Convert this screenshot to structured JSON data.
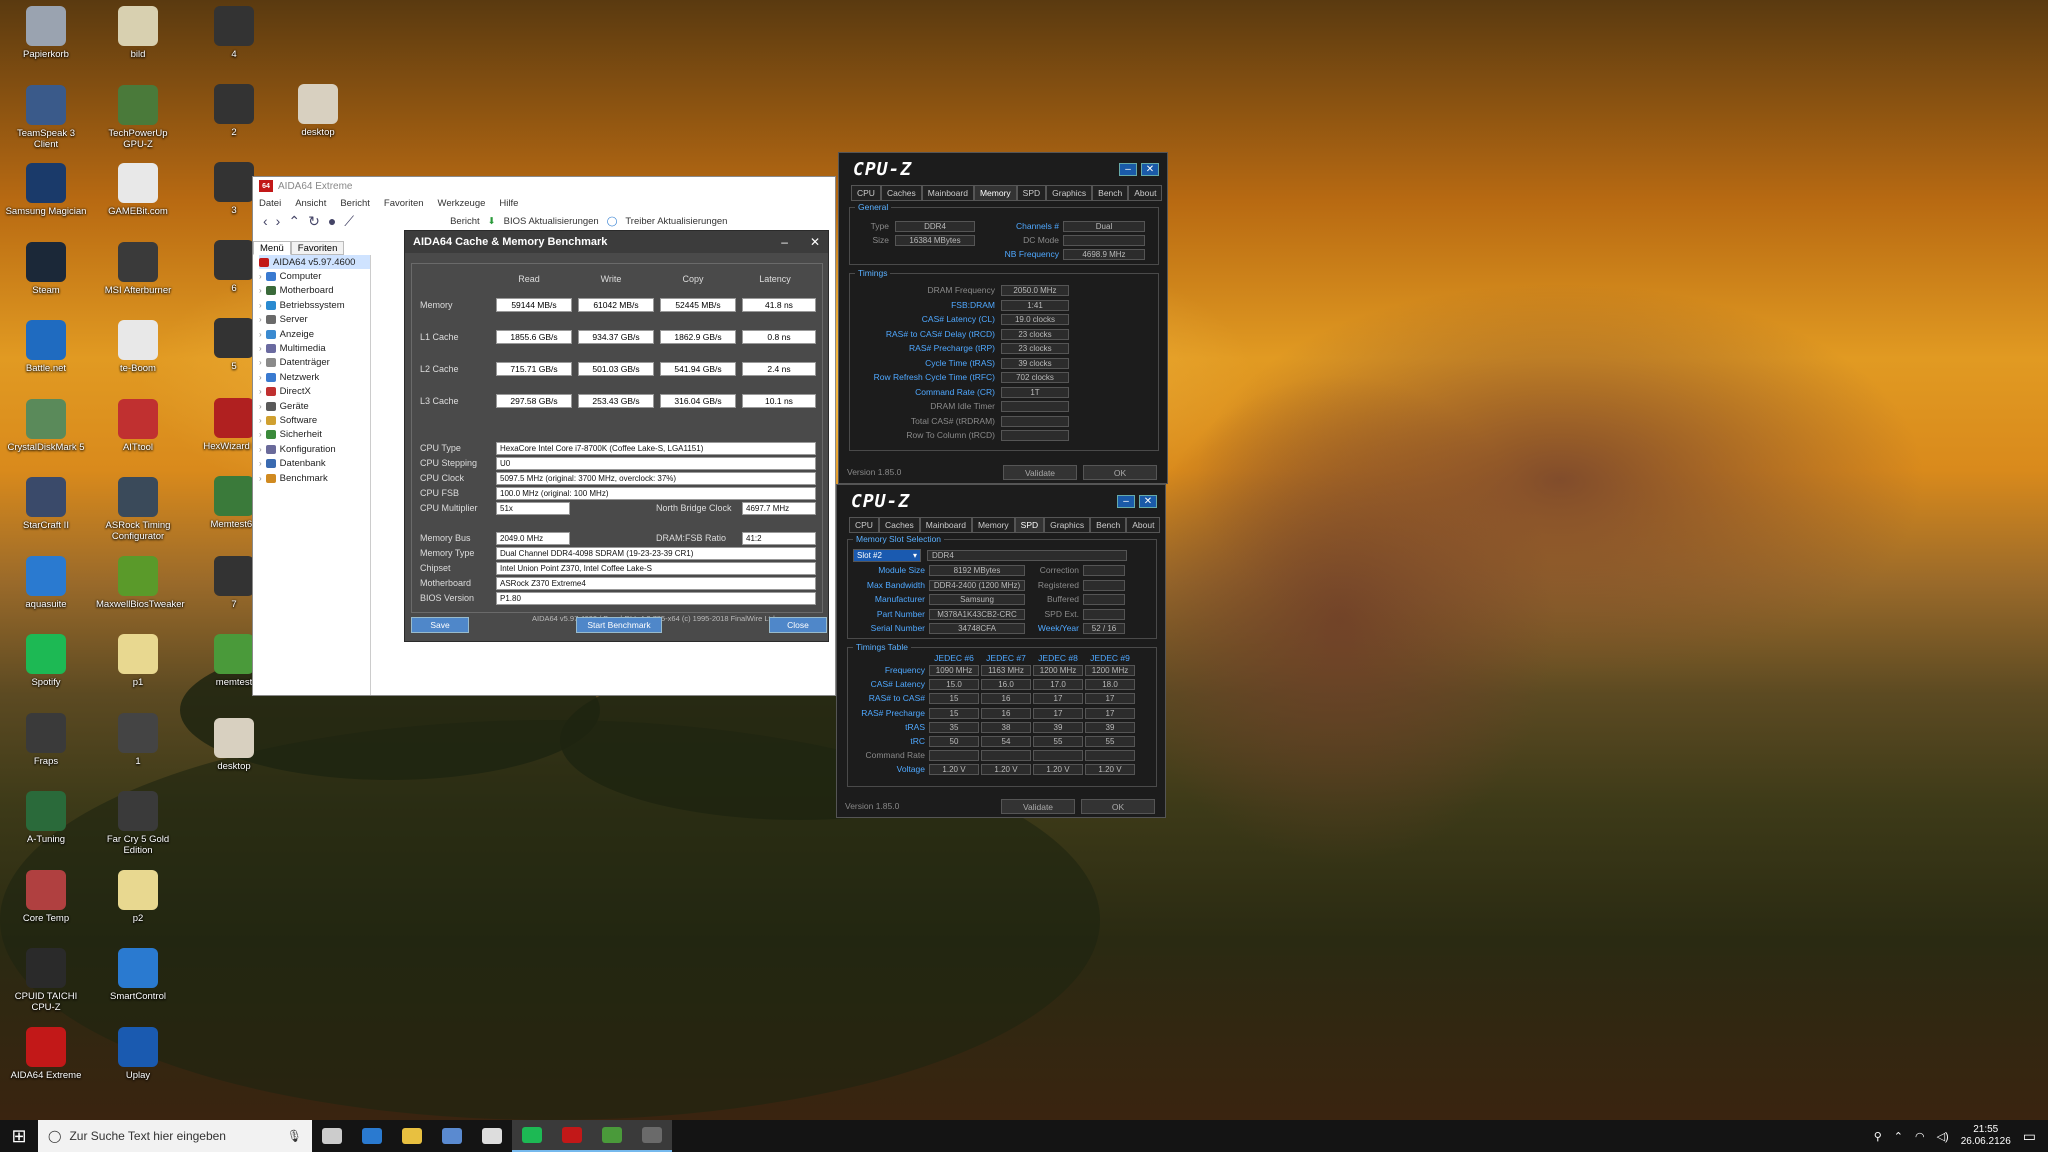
{
  "desktop_icons": [
    {
      "label": "Papierkorb",
      "color": "#9aa3b0"
    },
    {
      "label": "TeamSpeak 3 Client",
      "color": "#3a5a8a"
    },
    {
      "label": "Samsung Magician",
      "color": "#1a3a6a"
    },
    {
      "label": "Steam",
      "color": "#1b2838"
    },
    {
      "label": "Battle.net",
      "color": "#1f6bc0"
    },
    {
      "label": "CrystalDiskMark 5",
      "color": "#5a8a5a"
    },
    {
      "label": "StarCraft II",
      "color": "#3a4a6a"
    },
    {
      "label": "aquasuite",
      "color": "#2a7ad0"
    },
    {
      "label": "Spotify",
      "color": "#1db954"
    },
    {
      "label": "Fraps",
      "color": "#3a3a3a"
    },
    {
      "label": "A-Tuning",
      "color": "#2a6a3a"
    },
    {
      "label": "Core Temp",
      "color": "#b04040"
    },
    {
      "label": "CPUID TAICHI CPU-Z",
      "color": "#2a2a2a"
    },
    {
      "label": "AIDA64 Extreme",
      "color": "#c21818"
    },
    {
      "label": "bild",
      "color": "#d8d0b0"
    },
    {
      "label": "TechPowerUp GPU-Z",
      "color": "#4a7a3a"
    },
    {
      "label": "GAMEBit.com",
      "color": "#e8e8e8"
    },
    {
      "label": "MSI Afterburner",
      "color": "#3a3a3a"
    },
    {
      "label": "te-Boom",
      "color": "#e8e8e8"
    },
    {
      "label": "AITtool",
      "color": "#c03030"
    },
    {
      "label": "ASRock Timing Configurator",
      "color": "#3a4a5a"
    },
    {
      "label": "MaxwellBiosTweaker",
      "color": "#5a9a2a"
    },
    {
      "label": "p1",
      "color": "#e8d890"
    },
    {
      "label": "1",
      "color": "#444"
    },
    {
      "label": "Far Cry 5 Gold Edition",
      "color": "#3a3a3a"
    },
    {
      "label": "p2",
      "color": "#e8d890"
    },
    {
      "label": "SmartControl",
      "color": "#2a7ad0"
    },
    {
      "label": "Uplay",
      "color": "#1a5ab0"
    },
    {
      "label": "4",
      "color": "#333"
    },
    {
      "label": "2",
      "color": "#333"
    },
    {
      "label": "3",
      "color": "#333"
    },
    {
      "label": "6",
      "color": "#333"
    },
    {
      "label": "5",
      "color": "#333"
    },
    {
      "label": "HexWizard De",
      "color": "#b02020"
    },
    {
      "label": "Memtest64",
      "color": "#3a7a3a"
    },
    {
      "label": "7",
      "color": "#333"
    },
    {
      "label": "memtest",
      "color": "#4a9a3a"
    },
    {
      "label": "desktop",
      "color": "#d8d0c0"
    },
    {
      "label": "desktop",
      "color": "#d8d0c0"
    }
  ],
  "aida": {
    "title": "AIDA64 Extreme",
    "logo": "64",
    "menu": [
      "Datei",
      "Ansicht",
      "Bericht",
      "Favoriten",
      "Werkzeuge",
      "Hilfe"
    ],
    "toolbar": {
      "report": "Bericht",
      "bios": "BIOS Aktualisierungen",
      "driver": "Treiber Aktualisierungen"
    },
    "tabs": [
      "Menü",
      "Favoriten"
    ],
    "tree": [
      {
        "label": "AIDA64 v5.97.4600",
        "color": "#c21818"
      },
      {
        "label": "Computer",
        "color": "#3a7ad0"
      },
      {
        "label": "Motherboard",
        "color": "#3a6a3a"
      },
      {
        "label": "Betriebssystem",
        "color": "#2a8ad0"
      },
      {
        "label": "Server",
        "color": "#6a6a6a"
      },
      {
        "label": "Anzeige",
        "color": "#3a8ad0"
      },
      {
        "label": "Multimedia",
        "color": "#6a6aa0"
      },
      {
        "label": "Datenträger",
        "color": "#8a8a8a"
      },
      {
        "label": "Netzwerk",
        "color": "#3a7ad0"
      },
      {
        "label": "DirectX",
        "color": "#c03030"
      },
      {
        "label": "Geräte",
        "color": "#5a5a5a"
      },
      {
        "label": "Software",
        "color": "#d0a030"
      },
      {
        "label": "Sicherheit",
        "color": "#3a8a3a"
      },
      {
        "label": "Konfiguration",
        "color": "#6a6a9a"
      },
      {
        "label": "Datenbank",
        "color": "#3a6ab0"
      },
      {
        "label": "Benchmark",
        "color": "#d08a20"
      }
    ]
  },
  "bench": {
    "title": "AIDA64 Cache & Memory Benchmark",
    "cols": [
      "Read",
      "Write",
      "Copy",
      "Latency"
    ],
    "rows": [
      {
        "label": "Memory",
        "read": "59144 MB/s",
        "write": "61042 MB/s",
        "copy": "52445 MB/s",
        "latency": "41.8 ns"
      },
      {
        "label": "L1 Cache",
        "read": "1855.6 GB/s",
        "write": "934.37 GB/s",
        "copy": "1862.9 GB/s",
        "latency": "0.8 ns"
      },
      {
        "label": "L2 Cache",
        "read": "715.71 GB/s",
        "write": "501.03 GB/s",
        "copy": "541.94 GB/s",
        "latency": "2.4 ns"
      },
      {
        "label": "L3 Cache",
        "read": "297.58 GB/s",
        "write": "253.43 GB/s",
        "copy": "316.04 GB/s",
        "latency": "10.1 ns"
      }
    ],
    "cpu_type_label": "CPU Type",
    "cpu_type": "HexaCore Intel Core i7-8700K  (Coffee Lake-S, LGA1151)",
    "cpu_stepping_label": "CPU Stepping",
    "cpu_stepping": "U0",
    "cpu_clock_label": "CPU Clock",
    "cpu_clock": "5097.5 MHz  (original: 3700 MHz, overclock: 37%)",
    "cpu_fsb_label": "CPU FSB",
    "cpu_fsb": "100.0 MHz  (original: 100 MHz)",
    "cpu_mult_label": "CPU Multiplier",
    "cpu_mult": "51x",
    "nb_clock_label": "North Bridge Clock",
    "nb_clock": "4697.7 MHz",
    "mem_bus_label": "Memory Bus",
    "mem_bus": "2049.0 MHz",
    "dram_ratio_label": "DRAM:FSB Ratio",
    "dram_ratio": "41:2",
    "mem_type_label": "Memory Type",
    "mem_type": "Dual Channel DDR4-4098 SDRAM  (19-23-23-39 CR1)",
    "chipset_label": "Chipset",
    "chipset": "Intel Union Point Z370, Intel Coffee Lake-S",
    "mobo_label": "Motherboard",
    "mobo": "ASRock Z370 Extreme4",
    "bios_label": "BIOS Version",
    "bios": "P1.80",
    "footer": "AIDA64 v5.97.4600 / BenchDLL 4.3.785-x64  (c) 1995-2018 FinalWire Ltd.",
    "save": "Save",
    "start": "Start Benchmark",
    "close": "Close"
  },
  "cpuz1": {
    "logo": "CPU-Z",
    "tabs": [
      "CPU",
      "Caches",
      "Mainboard",
      "Memory",
      "SPD",
      "Graphics",
      "Bench",
      "About"
    ],
    "selected_tab": "Memory",
    "general": "General",
    "type_label": "Type",
    "type": "DDR4",
    "size_label": "Size",
    "size": "16384 MBytes",
    "channels_label": "Channels #",
    "channels": "Dual",
    "dcmode_label": "DC Mode",
    "nbfreq_label": "NB Frequency",
    "nbfreq": "4698.9 MHz",
    "timings": "Timings",
    "timing_rows": [
      {
        "label": "DRAM Frequency",
        "value": "2050.0 MHz",
        "dim": true
      },
      {
        "label": "FSB:DRAM",
        "value": "1:41",
        "dim": false
      },
      {
        "label": "CAS# Latency (CL)",
        "value": "19.0 clocks",
        "dim": false
      },
      {
        "label": "RAS# to CAS# Delay (tRCD)",
        "value": "23 clocks",
        "dim": false
      },
      {
        "label": "RAS# Precharge (tRP)",
        "value": "23 clocks",
        "dim": false
      },
      {
        "label": "Cycle Time (tRAS)",
        "value": "39 clocks",
        "dim": false
      },
      {
        "label": "Row Refresh Cycle Time (tRFC)",
        "value": "702 clocks",
        "dim": false
      },
      {
        "label": "Command Rate (CR)",
        "value": "1T",
        "dim": false
      },
      {
        "label": "DRAM Idle Timer",
        "value": "",
        "dim": true
      },
      {
        "label": "Total CAS# (tRDRAM)",
        "value": "",
        "dim": true
      },
      {
        "label": "Row To Column (tRCD)",
        "value": "",
        "dim": true
      }
    ],
    "version": "Version 1.85.0",
    "validate": "Validate",
    "ok": "OK"
  },
  "cpuz2": {
    "logo": "CPU-Z",
    "tabs": [
      "CPU",
      "Caches",
      "Mainboard",
      "Memory",
      "SPD",
      "Graphics",
      "Bench",
      "About"
    ],
    "selected_tab": "SPD",
    "slot_group": "Memory Slot Selection",
    "slot": "Slot #2",
    "slot_type": "DDR4",
    "mod_rows": [
      {
        "label": "Module Size",
        "value": "8192 MBytes"
      },
      {
        "label": "Max Bandwidth",
        "value": "DDR4-2400 (1200 MHz)"
      },
      {
        "label": "Manufacturer",
        "value": "Samsung"
      },
      {
        "label": "Part Number",
        "value": "M378A1K43CB2-CRC"
      },
      {
        "label": "Serial Number",
        "value": "34748CFA"
      }
    ],
    "right_rows": [
      {
        "label": "Correction",
        "value": ""
      },
      {
        "label": "Registered",
        "value": ""
      },
      {
        "label": "Buffered",
        "value": ""
      },
      {
        "label": "SPD Ext.",
        "value": ""
      },
      {
        "label": "Week/Year",
        "value": "52 / 16"
      }
    ],
    "timings_table": "Timings Table",
    "jedec_cols": [
      "JEDEC #6",
      "JEDEC #7",
      "JEDEC #8",
      "JEDEC #9"
    ],
    "jedec_rows": [
      {
        "label": "Frequency",
        "values": [
          "1090 MHz",
          "1163 MHz",
          "1200 MHz",
          "1200 MHz"
        ]
      },
      {
        "label": "CAS# Latency",
        "values": [
          "15.0",
          "16.0",
          "17.0",
          "18.0"
        ]
      },
      {
        "label": "RAS# to CAS#",
        "values": [
          "15",
          "16",
          "17",
          "17"
        ]
      },
      {
        "label": "RAS# Precharge",
        "values": [
          "15",
          "16",
          "17",
          "17"
        ]
      },
      {
        "label": "tRAS",
        "values": [
          "35",
          "38",
          "39",
          "39"
        ]
      },
      {
        "label": "tRC",
        "values": [
          "50",
          "54",
          "55",
          "55"
        ]
      },
      {
        "label": "Command Rate",
        "values": [
          "",
          "",
          "",
          ""
        ]
      },
      {
        "label": "Voltage",
        "values": [
          "1.20 V",
          "1.20 V",
          "1.20 V",
          "1.20 V"
        ]
      }
    ],
    "version": "Version 1.85.0",
    "validate": "Validate",
    "ok": "OK"
  },
  "taskbar": {
    "search_placeholder": "Zur Suche Text hier eingeben",
    "apps": [
      {
        "name": "task-view",
        "color": "#cccccc"
      },
      {
        "name": "edge",
        "color": "#2a7ad0"
      },
      {
        "name": "explorer",
        "color": "#e8c040"
      },
      {
        "name": "store",
        "color": "#5a8ad0"
      },
      {
        "name": "mail",
        "color": "#dddddd"
      },
      {
        "name": "spotify",
        "color": "#1db954"
      },
      {
        "name": "aida64",
        "color": "#c21818"
      },
      {
        "name": "memtest",
        "color": "#4a9a3a"
      },
      {
        "name": "cpu-z",
        "color": "#6a6a6a"
      }
    ],
    "time": "21:55",
    "date": "26.06.2126"
  }
}
